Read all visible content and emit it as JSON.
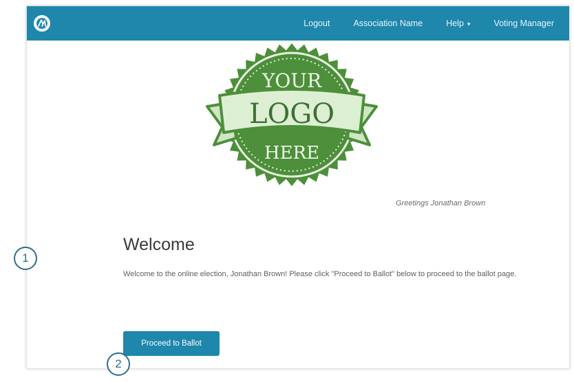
{
  "navbar": {
    "brand_icon": "app-logo-icon",
    "links": [
      {
        "label": "Logout"
      },
      {
        "label": "Association Name"
      },
      {
        "label": "Help",
        "caret": "▾"
      },
      {
        "label": "Voting Manager"
      }
    ],
    "color": "#1e87ab"
  },
  "logo": {
    "line1": "YOUR",
    "line2": "LOGO",
    "line3": "HERE",
    "seal_color": "#4d8f3a",
    "ribbon_color": "#d9ecd0"
  },
  "greeting": "Greetings Jonathan Brown",
  "welcome": {
    "title": "Welcome",
    "text": "Welcome to the online election, Jonathan Brown!  Please click \"Proceed to Ballot\" below to proceed to the ballot page."
  },
  "proceed_button": {
    "label": "Proceed to Ballot"
  },
  "markers": [
    {
      "label": "1"
    },
    {
      "label": "2"
    }
  ]
}
